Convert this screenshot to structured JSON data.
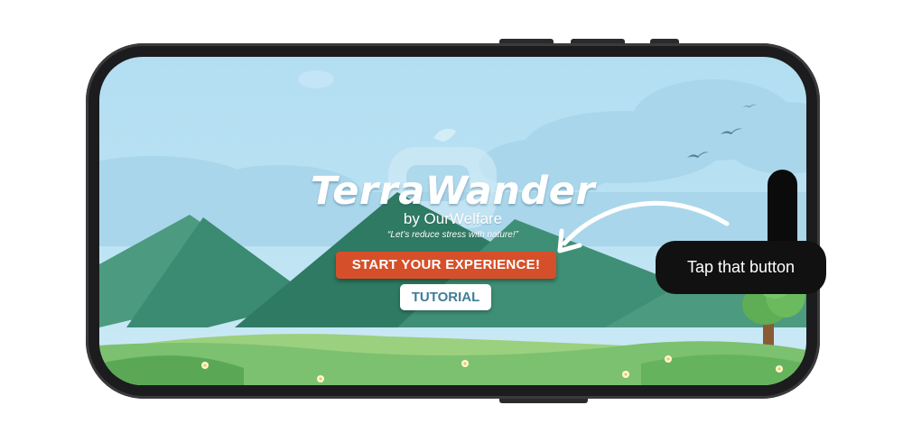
{
  "app": {
    "title": "TerraWander",
    "byline": "by OurWelfare",
    "tagline": "“Let’s reduce stress with nature!”"
  },
  "buttons": {
    "start_label": "START YOUR EXPERIENCE!",
    "tutorial_label": "TUTORIAL"
  },
  "annotation": {
    "tooltip_text": "Tap that button"
  },
  "colors": {
    "start_button": "#d5502a",
    "tutorial_text": "#3f7e9a",
    "sky": "#b3def2",
    "mountain": "#3b8a72",
    "grass": "#7cc16f",
    "tooltip_bg": "#111111"
  },
  "icons": [
    "bird-icon",
    "tree-icon",
    "flower-icon",
    "backpack-logo-icon",
    "arrow-icon"
  ]
}
